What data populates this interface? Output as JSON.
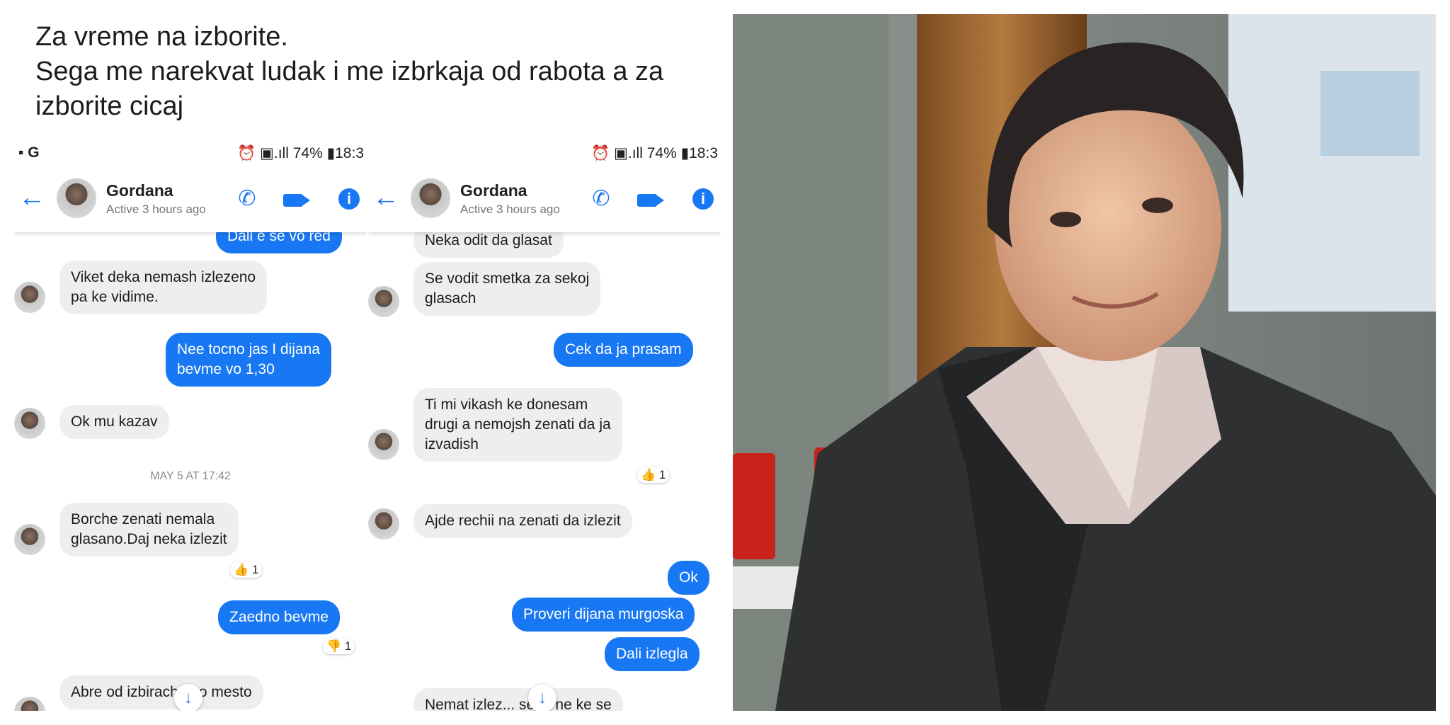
{
  "caption": {
    "line1": "Za vreme na izborite.",
    "line2": "Sega me narekvat ludak i me izbrkaja od rabota a za",
    "line3": "izborite cicaj"
  },
  "status_bar": {
    "left_text": "▪ G",
    "right_text": "⏰ ▣.ıll 74% ▮18:3"
  },
  "left_chat": {
    "contact_name": "Gordana",
    "active_status": "Active 3 hours ago",
    "messages": [
      {
        "text": "Dali e se vo red",
        "dir": "out"
      },
      {
        "text": "Viket deka nemash izlezeno\npa ke vidime.",
        "dir": "in"
      },
      {
        "text": "Nee tocno jas I dijana\nbevme vo 1,30",
        "dir": "out"
      },
      {
        "text": "Ok mu kazav",
        "dir": "in"
      },
      {
        "text": "Borche zenati nemala\nglasano.Daj neka izlezit",
        "dir": "in"
      },
      {
        "text": "Zaedno bevme",
        "dir": "out"
      },
      {
        "text": "Abre od izbirach... to mesto",
        "dir": "in"
      }
    ],
    "timestamp": "MAY 5 AT 17:42",
    "reactions": [
      "👍 1",
      "👎 1"
    ]
  },
  "right_chat": {
    "contact_name": "Gordana",
    "active_status": "Active 3 hours ago",
    "messages": [
      {
        "text": "Neka odit da glasat",
        "dir": "in"
      },
      {
        "text": "Se vodit smetka za sekoj\nglasach",
        "dir": "in"
      },
      {
        "text": "Cek da ja prasam",
        "dir": "out"
      },
      {
        "text": "Ti mi vikash ke donesam\ndrugi a nemojsh zenati da ja\nizvadish",
        "dir": "in"
      },
      {
        "text": "Ajde rechii na zenati da izlezit",
        "dir": "in"
      },
      {
        "text": "Ok",
        "dir": "out"
      },
      {
        "text": "Proveri dijana murgoska",
        "dir": "out"
      },
      {
        "text": "Dali izlegla",
        "dir": "out"
      },
      {
        "text": "Nemat izlez... sega ne ke se",
        "dir": "in"
      }
    ],
    "reactions": [
      "👍 1"
    ]
  },
  "icons": {
    "back": "arrow-left-icon",
    "call": "phone-icon",
    "video": "video-camera-icon",
    "info": "info-icon",
    "scroll_down": "arrow-down-icon"
  },
  "colors": {
    "messenger_blue": "#1877f2",
    "incoming_bubble": "#eceef0"
  }
}
